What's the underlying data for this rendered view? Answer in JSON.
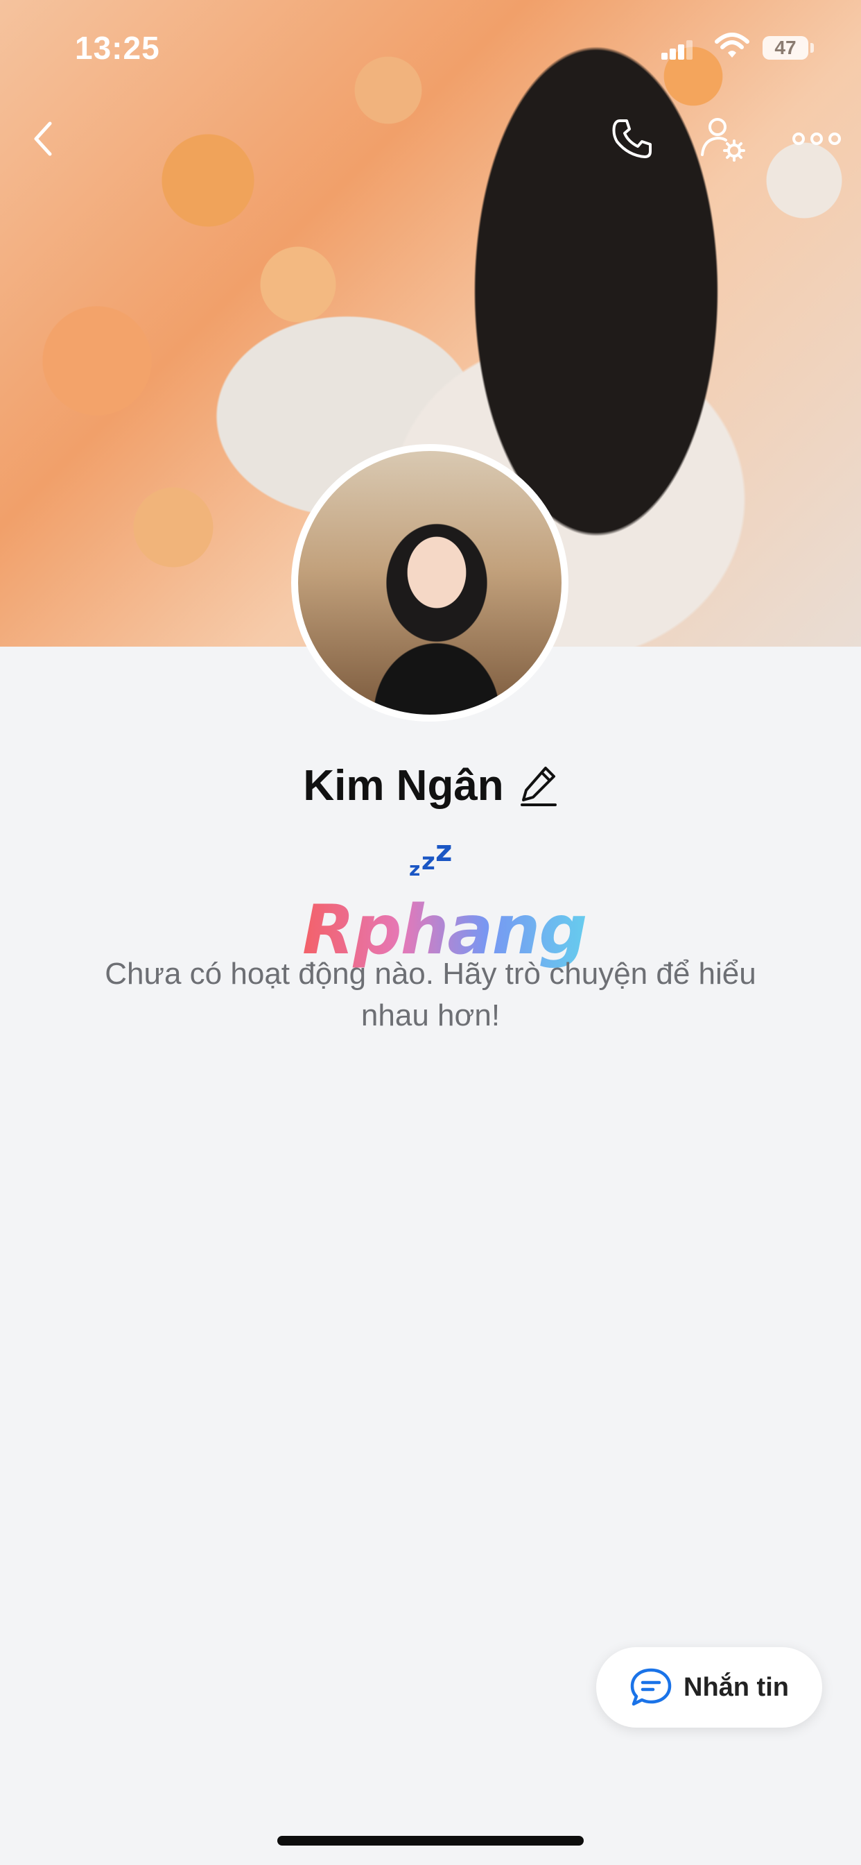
{
  "status_bar": {
    "time": "13:25",
    "battery_level": "47"
  },
  "header": {
    "back_icon": "chevron-left-icon",
    "call_icon": "phone-icon",
    "profile_settings_icon": "user-settings-icon",
    "more_icon": "more-horizontal-icon"
  },
  "profile": {
    "name": "Kim Ngân",
    "edit_icon": "pencil-icon",
    "status_icon": "sleep-zzz-icon",
    "empty_message": "Chưa có hoạt động nào. Hãy trò chuyện để hiểu nhau hơn!"
  },
  "watermark": {
    "text": "Rphang"
  },
  "message_button": {
    "label": "Nhắn tin",
    "icon": "chat-bubble-icon"
  },
  "colors": {
    "accent": "#1a73e8",
    "background": "#f3f4f6",
    "zzz": "#1a56c4"
  }
}
